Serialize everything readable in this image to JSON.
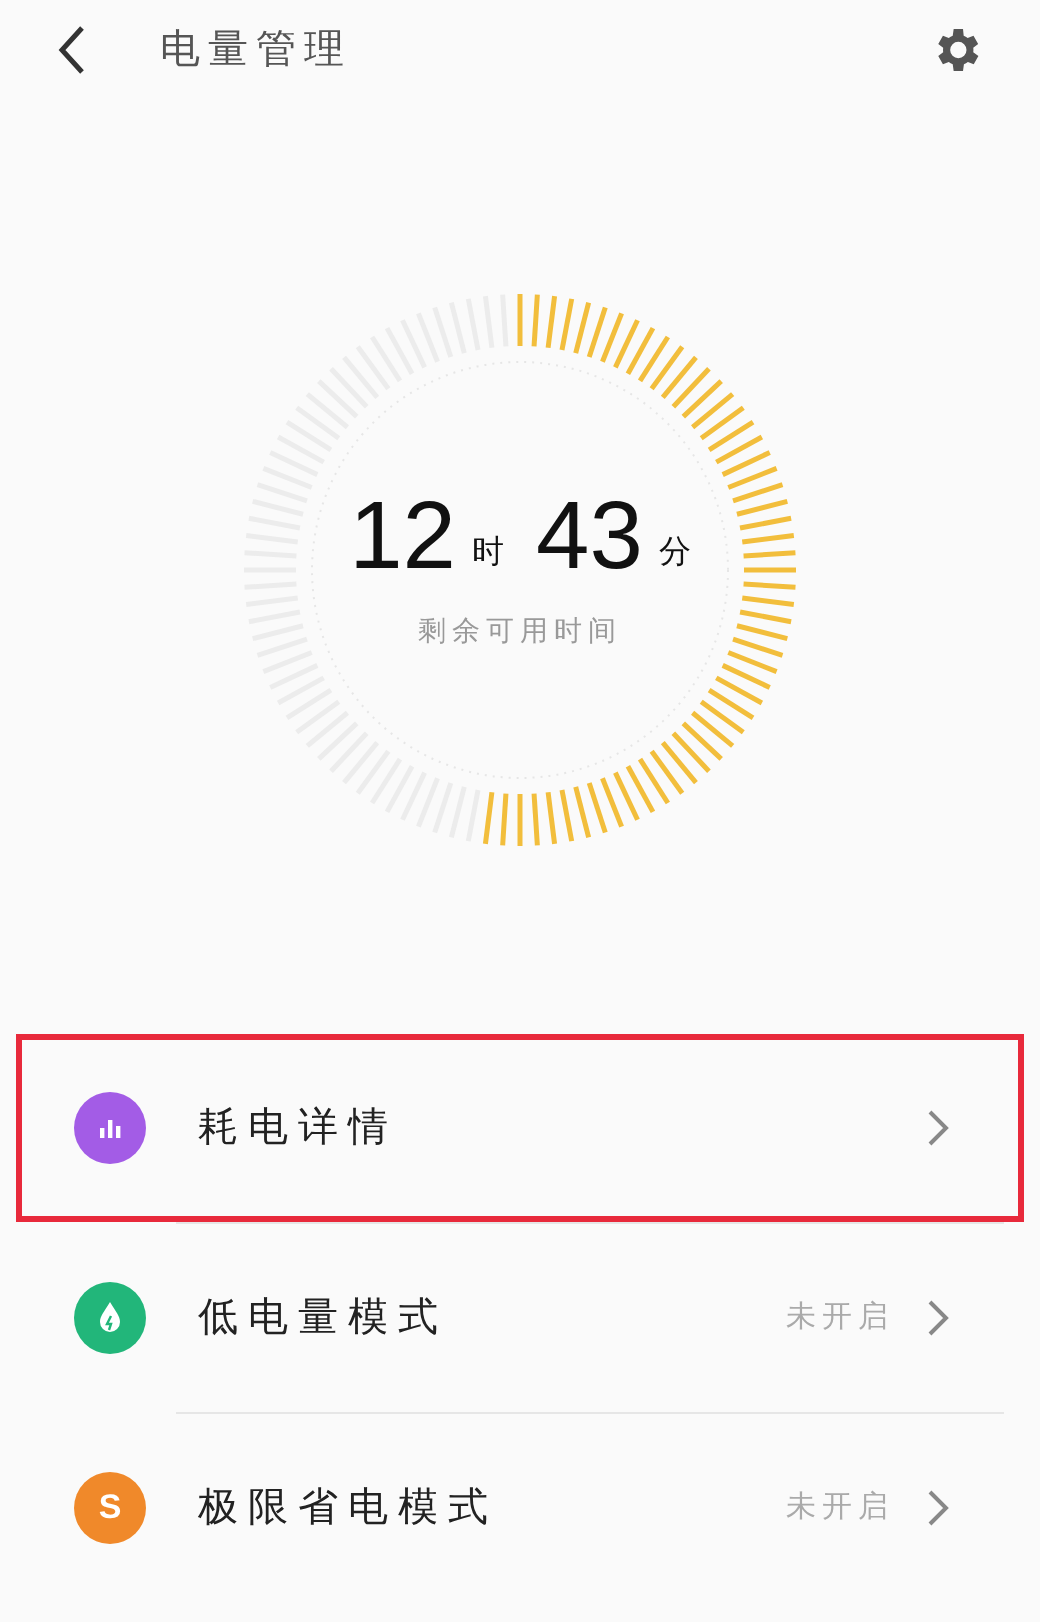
{
  "header": {
    "title": "电量管理"
  },
  "gauge": {
    "level": 0.53,
    "hours": "12",
    "hours_unit": "时",
    "minutes": "43",
    "minutes_unit": "分",
    "caption": "剩余可用时间"
  },
  "items": [
    {
      "label": "耗电详情",
      "kind": "chart",
      "color": "#a35ce6",
      "highlighted": true
    },
    {
      "label": "低电量模式",
      "kind": "drop",
      "color": "#22b67a",
      "status": "未开启",
      "highlighted": false
    },
    {
      "label": "极限省电模式",
      "kind": "letter",
      "icon_text": "S",
      "color": "#f0892a",
      "status": "未开启",
      "highlighted": false
    }
  ]
}
